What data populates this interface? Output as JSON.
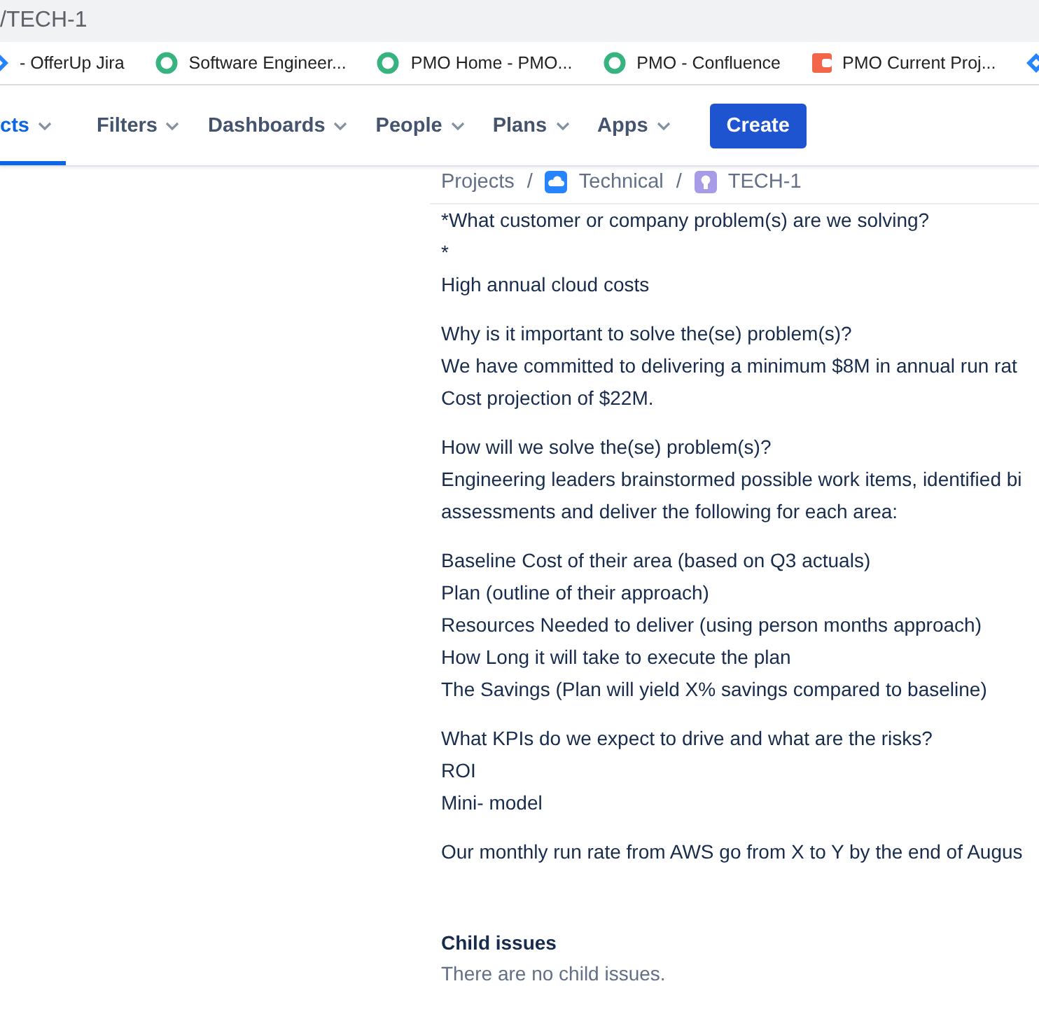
{
  "address_bar": {
    "url": "/TECH-1"
  },
  "bookmarks": [
    {
      "label": "- OfferUp Jira",
      "kind": "jira"
    },
    {
      "label": "Software Engineer...",
      "kind": "confluence"
    },
    {
      "label": "PMO Home - PMO...",
      "kind": "confluence"
    },
    {
      "label": "PMO - Confluence",
      "kind": "confluence"
    },
    {
      "label": "PMO Current Proj...",
      "kind": "doc"
    },
    {
      "kind": "jira"
    }
  ],
  "nav": {
    "items": [
      {
        "label": "cts",
        "selected": true
      },
      {
        "label": "Filters",
        "selected": false
      },
      {
        "label": "Dashboards",
        "selected": false
      },
      {
        "label": "People",
        "selected": false
      },
      {
        "label": "Plans",
        "selected": false
      },
      {
        "label": "Apps",
        "selected": false
      }
    ],
    "create_button": "Create"
  },
  "breadcrumb_separator": "/",
  "breadcrumbs": [
    {
      "label": "Projects"
    },
    {
      "label": "Technical",
      "kind": "project"
    },
    {
      "label": "TECH-1",
      "kind": "issue"
    }
  ],
  "description": [
    [
      "*What customer or company problem(s) are we solving?",
      "*",
      "High annual cloud costs"
    ],
    [
      "Why is it important to solve the(se) problem(s)?",
      "We have committed to delivering a minimum $8M in annual run rat",
      "Cost projection of $22M."
    ],
    [
      "How will we solve the(se) problem(s)?",
      "Engineering leaders brainstormed possible work items, identified bi",
      "assessments and deliver the following for each area:"
    ],
    [
      "Baseline Cost of their area (based on Q3 actuals)",
      "Plan (outline of their approach)",
      "Resources Needed to deliver (using person months approach)",
      "How Long it will take to execute the plan",
      "The Savings (Plan will yield X% savings compared to baseline)"
    ],
    [
      "What KPIs do we expect to drive and what are the risks?",
      "ROI",
      "Mini- model"
    ],
    [
      "Our monthly run rate from AWS go from X to Y by the end of Augus"
    ]
  ],
  "child_issues": {
    "title": "Child issues",
    "empty_text": "There are no child issues."
  }
}
